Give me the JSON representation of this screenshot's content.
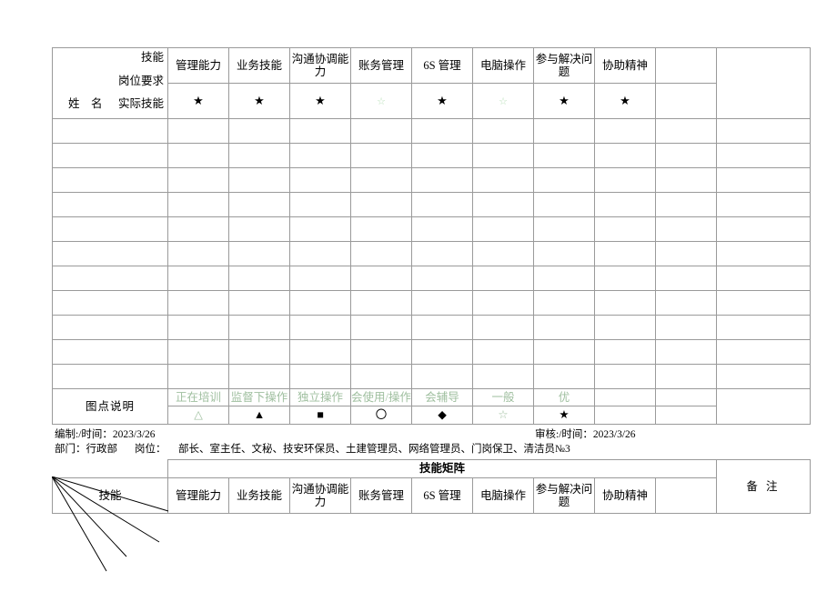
{
  "document": {
    "title": "技能矩阵",
    "corner": {
      "skill_label": "技能",
      "requirement_label": "岗位要求",
      "name_label": "姓　名",
      "actual_label": "实际技能"
    }
  },
  "skills": [
    "管理能力",
    "业务技能",
    "沟通协调能力",
    "账务管理",
    "6S 管理",
    "电脑操作",
    "参与解决问题",
    "协助精神"
  ],
  "requirement_row": {
    "symbols": [
      "★",
      "★",
      "★",
      "☆",
      "★",
      "☆",
      "★",
      "★"
    ],
    "filled": [
      true,
      true,
      true,
      false,
      true,
      false,
      true,
      true
    ]
  },
  "empty_row_count": 11,
  "legend": {
    "title": "图点说明",
    "entries": [
      {
        "label": "正在培训",
        "symbol": "△",
        "dark": false
      },
      {
        "label": "监督下操作",
        "symbol": "▲",
        "dark": true
      },
      {
        "label": "独立操作",
        "symbol": "■",
        "dark": true
      },
      {
        "label": "会使用/操作",
        "symbol": "〇",
        "dark": true
      },
      {
        "label": "会辅导",
        "symbol": "◆",
        "dark": true
      },
      {
        "label": "一般",
        "symbol": "☆",
        "dark": false
      },
      {
        "label": "优",
        "symbol": "★",
        "dark": true
      },
      {
        "label": "",
        "symbol": "",
        "dark": false
      }
    ]
  },
  "footer": {
    "prepared": "编制:/时间：2023/3/26",
    "checked": "审核:/时间：2023/3/26",
    "department": "部门：行政部",
    "position_label": "岗位：",
    "positions": "部长、室主任、文秘、技安环保员、土建管理员、网络管理员、门岗保卫、清洁员№3"
  },
  "bottom_table": {
    "title": "技能矩阵",
    "corner_label": "技能",
    "skills": [
      "管理能力",
      "业务技能",
      "沟通协调能力",
      "账务管理",
      "6S 管理",
      "电脑操作",
      "参与解决问题",
      "协助精神"
    ],
    "remark_header": "备 注"
  },
  "colors": {
    "green_fill": "#ccf5cc",
    "grid_line": "#9a9a9a",
    "legend_text": "#9fbf9f"
  }
}
